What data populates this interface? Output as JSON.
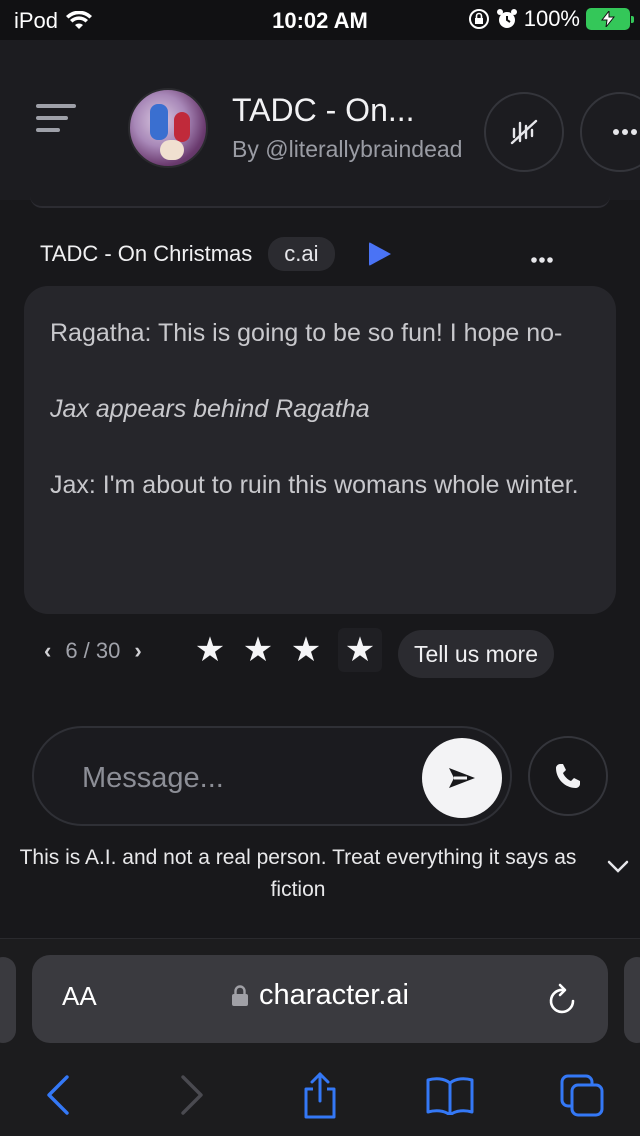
{
  "status_bar": {
    "device": "iPod",
    "time": "10:02 AM",
    "battery": "100%"
  },
  "header": {
    "title": "TADC - On...",
    "author": "By @literallybraindead",
    "icons": [
      "menu-icon",
      "mute-icon",
      "more-icon"
    ]
  },
  "message": {
    "name": "TADC - On Christmas",
    "badge": "c.ai",
    "more": "•••",
    "paragraphs": [
      "Ragatha: This is going to be so fun! I hope no-",
      "Jax appears behind Ragatha",
      "Jax: I'm about to ruin this womans whole winter."
    ]
  },
  "rating": {
    "pager": "6 / 30",
    "stars": 4,
    "tell_more": "Tell us more"
  },
  "input": {
    "placeholder": "Message...",
    "value": ""
  },
  "disclaimer": "This is A.I. and not a real person. Treat everything it says as fiction",
  "safari": {
    "text_size": "AA",
    "url": "character.ai",
    "accent": "#3478f6"
  }
}
